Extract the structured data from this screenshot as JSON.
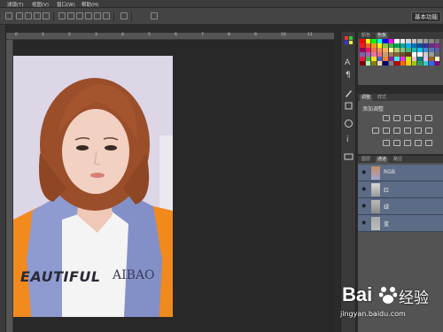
{
  "menubar": {
    "items": [
      "滤镜(T)",
      "视图(V)",
      "窗口(W)",
      "帮助(H)"
    ]
  },
  "optionsbar": {
    "workspace_label": "基本功能"
  },
  "ruler": {
    "labels": [
      "0",
      "1",
      "2",
      "3",
      "4",
      "5",
      "6",
      "7",
      "8",
      "9",
      "10",
      "11"
    ]
  },
  "swatches_panel": {
    "tabs": [
      "颜色",
      "色板"
    ],
    "colors": [
      [
        "#ff0000",
        "#ffff00",
        "#00ff00",
        "#00ffff",
        "#0000ff",
        "#ff00ff",
        "#ffffff",
        "#ebebeb",
        "#d6d6d6",
        "#c2c2c2",
        "#adadad",
        "#999999",
        "#858585",
        "#707070"
      ],
      [
        "#ed1c24",
        "#f26522",
        "#f7941d",
        "#fff200",
        "#8dc63f",
        "#39b54a",
        "#00a651",
        "#00a99d",
        "#00aeef",
        "#0072bc",
        "#0054a6",
        "#2e3192",
        "#662d91",
        "#92278f"
      ],
      [
        "#9e005d",
        "#ed145b",
        "#f26c4f",
        "#f68e56",
        "#fbaf5d",
        "#fff799",
        "#acd373",
        "#7cc576",
        "#3bb878",
        "#1abbb4",
        "#00bff3",
        "#438ccb",
        "#5574b9",
        "#605ca8"
      ],
      [
        "#855fa8",
        "#a763a8",
        "#f06eaa",
        "#f26d7d",
        "#c69c6d",
        "#a67c52",
        "#8c6239",
        "#754c24",
        "#603913",
        "#ffffff",
        "#f2f2f2",
        "#cccccc",
        "#999999",
        "#666666"
      ],
      [
        "#e6194b",
        "#3cb44b",
        "#ffe119",
        "#4363d8",
        "#f58231",
        "#911eb4",
        "#46f0f0",
        "#f032e6",
        "#bcf60c",
        "#fabebe",
        "#008080",
        "#e6beff",
        "#9a6324",
        "#fffac8"
      ],
      [
        "#800000",
        "#aaffc3",
        "#808000",
        "#ffd8b1",
        "#000075",
        "#808080",
        "#c00000",
        "#ff6600",
        "#ffcc00",
        "#99cc00",
        "#339966",
        "#33cccc",
        "#3366ff",
        "#800080"
      ]
    ]
  },
  "adjustments_panel": {
    "tabs": [
      "调整",
      "样式"
    ],
    "title": "添加调整"
  },
  "channels_panel": {
    "tabs": [
      "图层",
      "通道",
      "路径"
    ],
    "rows": [
      {
        "name": "RGB"
      },
      {
        "name": "红"
      },
      {
        "name": "绿"
      },
      {
        "name": "蓝"
      }
    ]
  },
  "photo": {
    "shirt_text_left": "EAUTIFUL",
    "shirt_text_right": "AIBAO"
  },
  "watermark": {
    "brand": "Bai",
    "brand2": "经验",
    "url": "jingyan.baidu.com"
  }
}
